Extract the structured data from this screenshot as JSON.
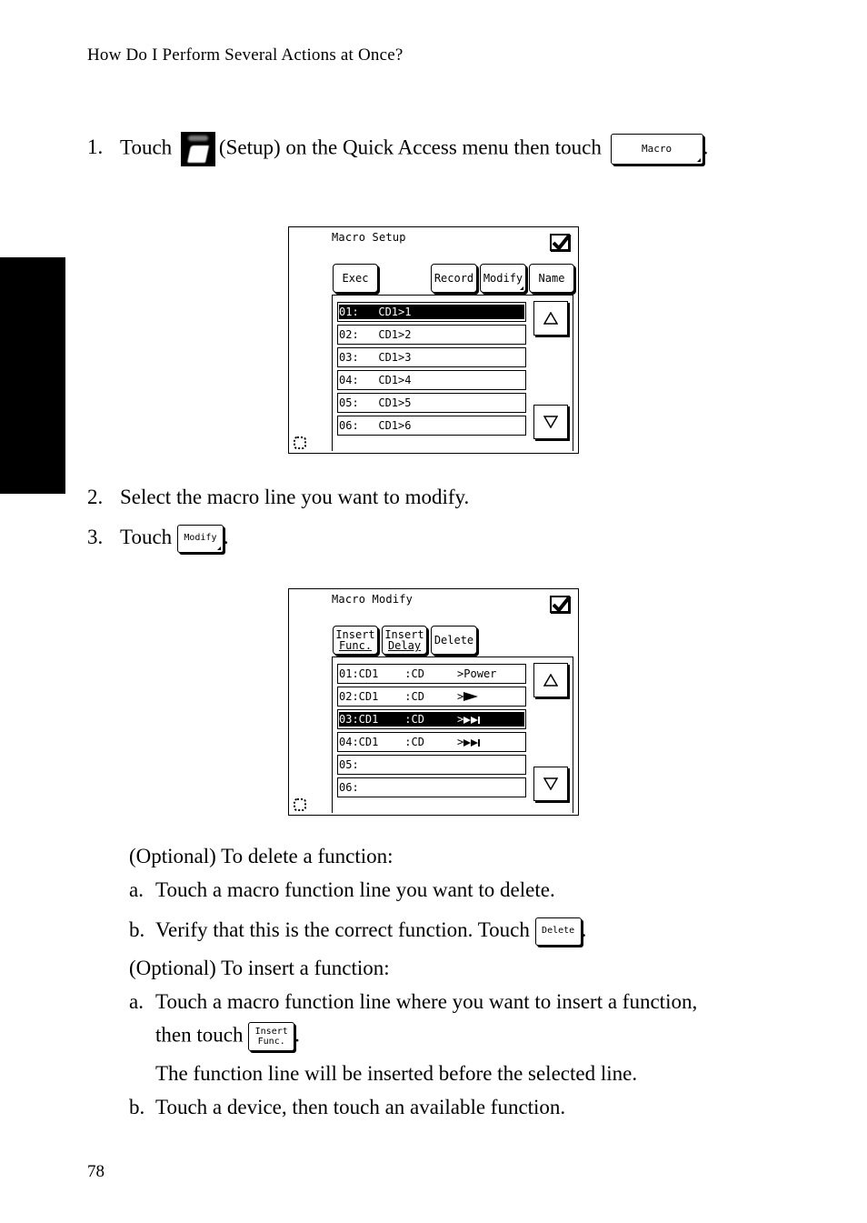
{
  "running_head": "How Do I Perform Several Actions at Once?",
  "page_number": "78",
  "steps": {
    "step1": {
      "number": "1.",
      "text_before": "Touch",
      "icon": "setup-icon",
      "text_middle": "(Setup) on the Quick Access menu then touch",
      "button_label": "Macro",
      "text_after": "."
    },
    "step2": {
      "number": "2.",
      "text": "Select the macro line you want to modify."
    },
    "step3": {
      "number": "3.",
      "text_before": "Touch",
      "button_label": "Modify",
      "text_after": "."
    }
  },
  "screen_setup": {
    "title": "Macro Setup",
    "ok_icon": "checkmark-icon",
    "buttons": {
      "exec": "Exec",
      "record": "Record",
      "modify": "Modify",
      "name": "Name"
    },
    "rows": [
      {
        "text": "01:   CD1>1",
        "selected": true
      },
      {
        "text": "02:   CD1>2",
        "selected": false
      },
      {
        "text": "03:   CD1>3",
        "selected": false
      },
      {
        "text": "04:   CD1>4",
        "selected": false
      },
      {
        "text": "05:   CD1>5",
        "selected": false
      },
      {
        "text": "06:   CD1>6",
        "selected": false
      }
    ],
    "scroll_up_icon": "triangle-up-icon",
    "scroll_down_icon": "triangle-down-icon",
    "status_icon": "busy-indicator-icon"
  },
  "screen_modify": {
    "title": "Macro Modify",
    "ok_icon": "checkmark-icon",
    "buttons": {
      "insert_func_line1": "Insert",
      "insert_func_line2": "Func.",
      "insert_delay_line1": "Insert",
      "insert_delay_line2": "Delay",
      "delete": "Delete"
    },
    "rows": [
      {
        "text": "01:CD1    :CD     >Power",
        "glyph": "",
        "selected": false
      },
      {
        "text": "02:CD1    :CD     >",
        "glyph": "play",
        "selected": false
      },
      {
        "text": "03:CD1    :CD     >",
        "glyph": "skip-forward",
        "selected": true
      },
      {
        "text": "04:CD1    :CD     >",
        "glyph": "skip-forward",
        "selected": false
      },
      {
        "text": "05:",
        "glyph": "",
        "selected": false
      },
      {
        "text": "06:",
        "glyph": "",
        "selected": false
      }
    ]
  },
  "optional_delete": {
    "heading": "(Optional) To delete a function:",
    "a": {
      "label": "a.",
      "text": "Touch a macro function line you want to delete."
    },
    "b": {
      "label": "b.",
      "text_before": "Verify that this is the correct function. Touch",
      "button_label": "Delete",
      "text_after": "."
    }
  },
  "optional_insert": {
    "heading": "(Optional) To insert a function:",
    "a": {
      "label": "a.",
      "text_line1": "Touch a macro function line where you want to insert a function,",
      "text_line2_before": "then touch",
      "button_line1": "Insert",
      "button_line2": "Func.",
      "text_after": ".",
      "note": "The function line will be inserted before the selected line."
    },
    "b": {
      "label": "b.",
      "text": "Touch a device, then touch an available function."
    }
  }
}
